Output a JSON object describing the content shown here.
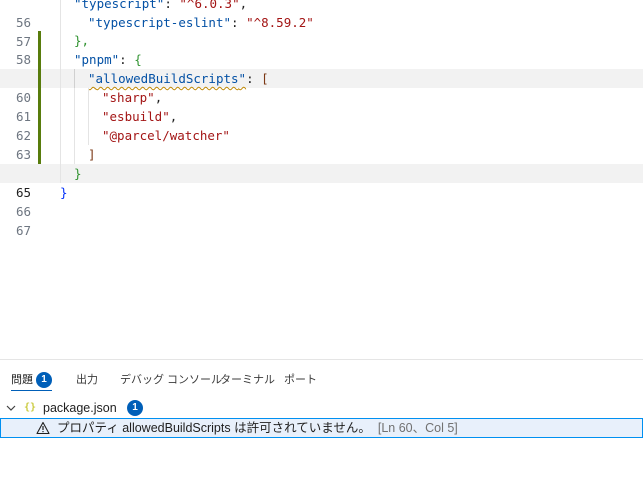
{
  "editor": {
    "lines": [
      {
        "num": "56",
        "indent": 1,
        "key": "typescript",
        "value": "^6.0.3",
        "suffix": ","
      },
      {
        "num": "57",
        "indent": 1,
        "key": "typescript-eslint",
        "value": "^8.59.2",
        "suffix": ""
      },
      {
        "num": "58",
        "indent": 0,
        "text": "},"
      },
      {
        "num": "59",
        "indent": 0,
        "key": "pnpm",
        "open": "{"
      },
      {
        "num": "60",
        "indent": 1,
        "key": "allowedBuildScripts",
        "open": "["
      },
      {
        "num": "61",
        "indent": 2,
        "value": "sharp",
        "suffix": ","
      },
      {
        "num": "62",
        "indent": 2,
        "value": "esbuild",
        "suffix": ","
      },
      {
        "num": "63",
        "indent": 2,
        "value": "@parcel/watcher",
        "suffix": ""
      },
      {
        "num": "64",
        "indent": 1,
        "text": "]"
      },
      {
        "num": "65",
        "indent": 0,
        "text": "}"
      },
      {
        "num": "66",
        "indent": -1,
        "text": "}"
      },
      {
        "num": "67",
        "indent": -1,
        "text": ""
      }
    ]
  },
  "panel": {
    "tabs": [
      {
        "label": "問題",
        "badge": "1"
      },
      {
        "label": "出力"
      },
      {
        "label": "デバッグ コンソール"
      },
      {
        "label": "ターミナル"
      },
      {
        "label": "ポート"
      }
    ],
    "file": {
      "icon": "{}",
      "name": "package.json",
      "count": "1"
    },
    "problem": {
      "message": "プロパティ allowedBuildScripts は許可されていません。",
      "location": "[Ln 60、Col 5]"
    }
  },
  "colors": {
    "accent": "#005fb8",
    "warning": "#bf8803",
    "change_bar": "#587c0c"
  }
}
